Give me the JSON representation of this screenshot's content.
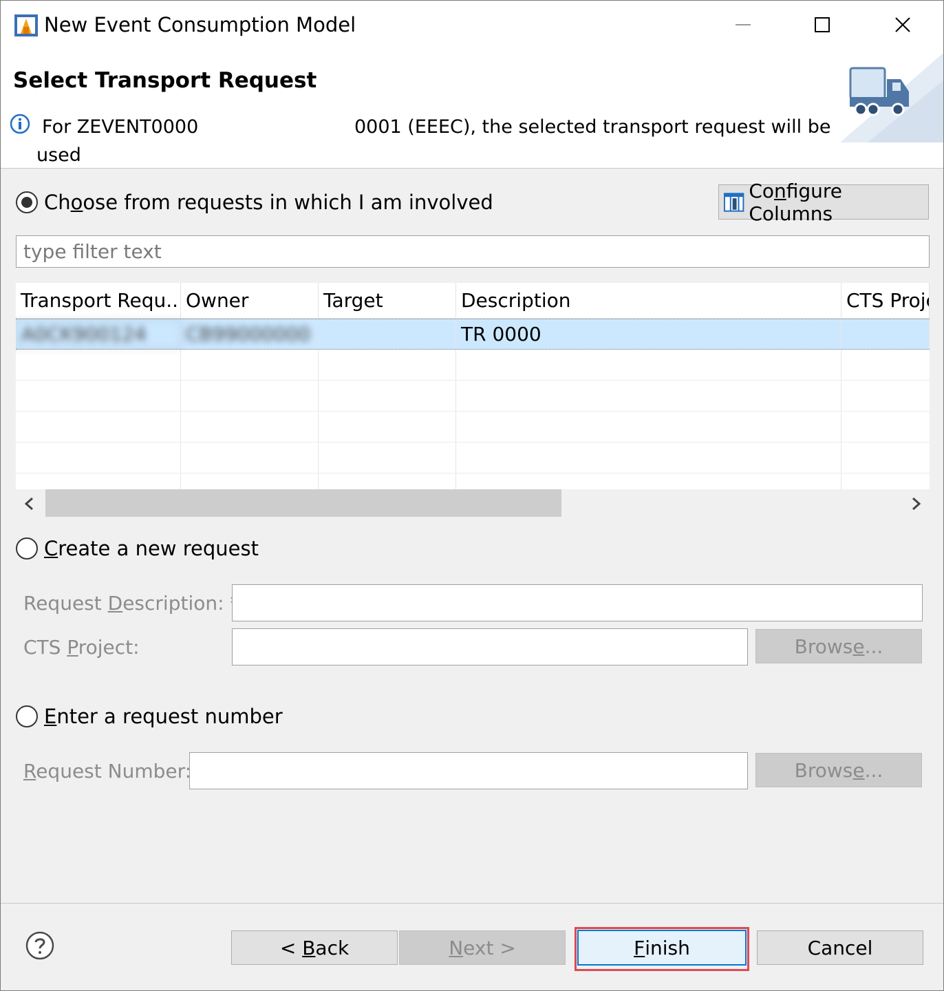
{
  "window": {
    "title": "New Event Consumption Model",
    "controls": {
      "minimize": "—",
      "maximize": "☐",
      "close": "✕"
    }
  },
  "header": {
    "title": "Select Transport Request",
    "message_part1": "For ZEVENT0000",
    "message_part2": "0001 (EEEC), the selected transport request will be",
    "message_part3": "used"
  },
  "options": {
    "choose": {
      "label_pre": "Ch",
      "label_mnemonic": "o",
      "label_post": "ose from requests in which I am involved",
      "selected": true
    },
    "configure_columns": {
      "label_pre": "Co",
      "label_mnemonic": "n",
      "label_post": "figure Columns"
    },
    "filter": {
      "placeholder": "type filter text",
      "value": ""
    },
    "table": {
      "columns": [
        "Transport Requ...",
        "Owner",
        "Target",
        "Description",
        "CTS Proje"
      ],
      "rows": [
        {
          "transport_request": "A0CK900124",
          "owner": "CB99000000 ...",
          "target": "",
          "description": "TR 0000",
          "cts_project": ""
        }
      ]
    },
    "create": {
      "label_mnemonic": "C",
      "label_post": "reate a new request",
      "selected": false,
      "description_label_pre": "Request ",
      "description_label_mnemonic": "D",
      "description_label_post": "escription: *",
      "description_value": "",
      "cts_label_pre": "CTS ",
      "cts_label_mnemonic": "P",
      "cts_label_post": "roject:",
      "cts_value": "",
      "browse_pre": "Brows",
      "browse_mnemonic": "e",
      "browse_post": "..."
    },
    "enter": {
      "label_mnemonic": "E",
      "label_post": "nter a request number",
      "selected": false,
      "number_label_mnemonic": "R",
      "number_label_post": "equest Number:",
      "number_value": "",
      "browse_pre": "Brows",
      "browse_mnemonic": "e",
      "browse_post": "..."
    }
  },
  "footer": {
    "help_icon": "?",
    "back": {
      "pre": "< ",
      "mnemonic": "B",
      "post": "ack"
    },
    "next": {
      "mnemonic": "N",
      "post": "ext >"
    },
    "finish": {
      "mnemonic": "F",
      "post": "inish"
    },
    "cancel": "Cancel"
  },
  "colors": {
    "selection": "#cce8ff",
    "highlight_border": "#e0484f",
    "dialog_bg": "#f0f0f0"
  }
}
